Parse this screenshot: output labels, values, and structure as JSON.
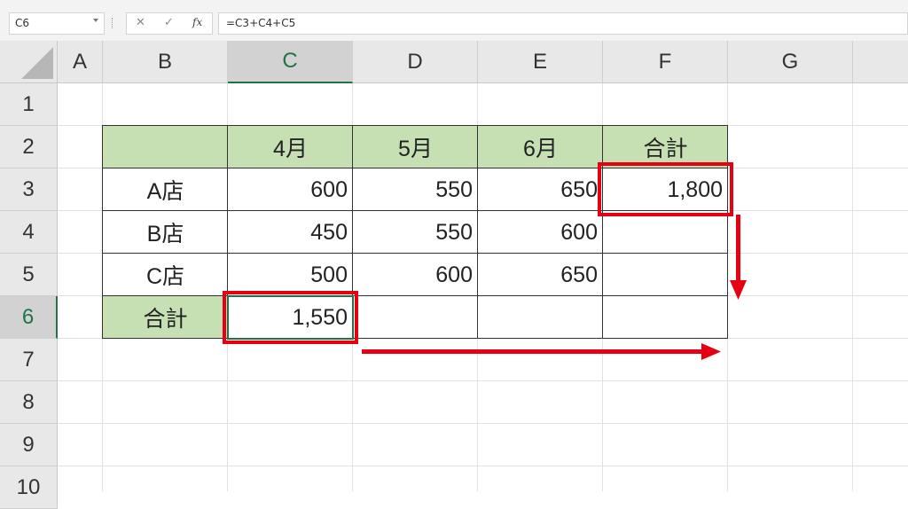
{
  "formula_bar": {
    "name_box": "C6",
    "cancel_icon": "✕",
    "enter_icon": "✓",
    "fx_label": "fx",
    "formula": "=C3+C4+C5"
  },
  "columns": [
    "A",
    "B",
    "C",
    "D",
    "E",
    "F",
    "G"
  ],
  "rows": [
    "1",
    "2",
    "3",
    "4",
    "5",
    "6",
    "7",
    "8",
    "9",
    "10"
  ],
  "selected_cell": "C6",
  "table": {
    "header": [
      "",
      "4月",
      "5月",
      "6月",
      "合計"
    ],
    "rows": [
      [
        "A店",
        "600",
        "550",
        "650",
        "1,800"
      ],
      [
        "B店",
        "450",
        "550",
        "600",
        ""
      ],
      [
        "C店",
        "500",
        "600",
        "650",
        ""
      ],
      [
        "合計",
        "1,550",
        "",
        "",
        ""
      ]
    ]
  },
  "colors": {
    "header_fill": "#c6e0b4",
    "highlight": "#e60012",
    "selection": "#217346"
  }
}
